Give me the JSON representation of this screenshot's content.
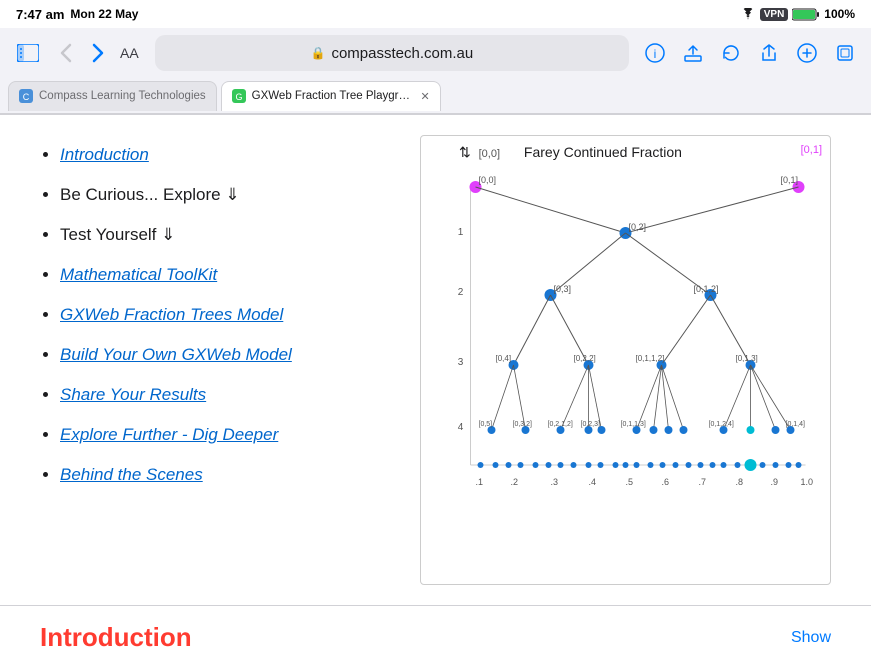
{
  "statusBar": {
    "time": "7:47 am",
    "day": "Mon 22 May",
    "battery": "100%",
    "wifi": true,
    "vpn": true
  },
  "browser": {
    "url": "compasstech.com.au",
    "aa_label": "AA",
    "back_disabled": true,
    "forward_disabled": false
  },
  "tabs": [
    {
      "id": "tab1",
      "label": "Compass Learning Technologies",
      "favicon": "C",
      "active": false,
      "closable": false
    },
    {
      "id": "tab2",
      "label": "GXWeb Fraction Tree Playground",
      "favicon": "G",
      "active": true,
      "closable": true
    }
  ],
  "nav": {
    "items": [
      {
        "id": "intro",
        "label": "Introduction",
        "link": true
      },
      {
        "id": "curious",
        "label": "Be Curious... Explore ⇓",
        "link": false
      },
      {
        "id": "test",
        "label": "Test Yourself ⇓",
        "link": false
      },
      {
        "id": "toolkit",
        "label": "Mathematical ToolKit",
        "link": true
      },
      {
        "id": "model",
        "label": "GXWeb Fraction Trees Model",
        "link": true
      },
      {
        "id": "build",
        "label": "Build Your Own GXWeb Model",
        "link": true
      },
      {
        "id": "share",
        "label": "Share Your Results",
        "link": true
      },
      {
        "id": "explore",
        "label": "Explore Further - Dig Deeper",
        "link": true
      },
      {
        "id": "scenes",
        "label": "Behind the Scenes",
        "link": true
      }
    ]
  },
  "farey": {
    "title": "Farey Continued Fraction"
  },
  "bottomSection": {
    "title": "Introduction",
    "showButton": "Show"
  },
  "icons": {
    "sidebar": "⊞",
    "back": "‹",
    "forward": "›",
    "lock": "🔒",
    "info": "ⓘ",
    "share": "⬆",
    "refresh": "↻",
    "add_tab": "+",
    "tabs": "⧉"
  }
}
